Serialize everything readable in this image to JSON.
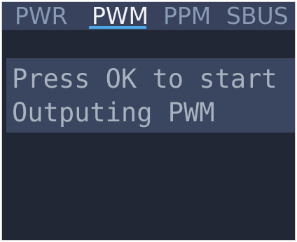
{
  "tabs": [
    {
      "label": "PWR",
      "active": false
    },
    {
      "label": "PWM",
      "active": true
    },
    {
      "label": "PPM",
      "active": false
    },
    {
      "label": "SBUS",
      "active": false
    }
  ],
  "message": {
    "line1": "Press OK to start",
    "line2": "Outputing PWM"
  },
  "colors": {
    "screen_background": "#222736",
    "tabbar_background": "#39425c",
    "inactive_tab": "#8a9ab4",
    "active_tab": "#f2f4f8",
    "active_underline": "#4aa8e6",
    "message_panel": "#3a4560",
    "message_text": "#a9b3bf"
  }
}
